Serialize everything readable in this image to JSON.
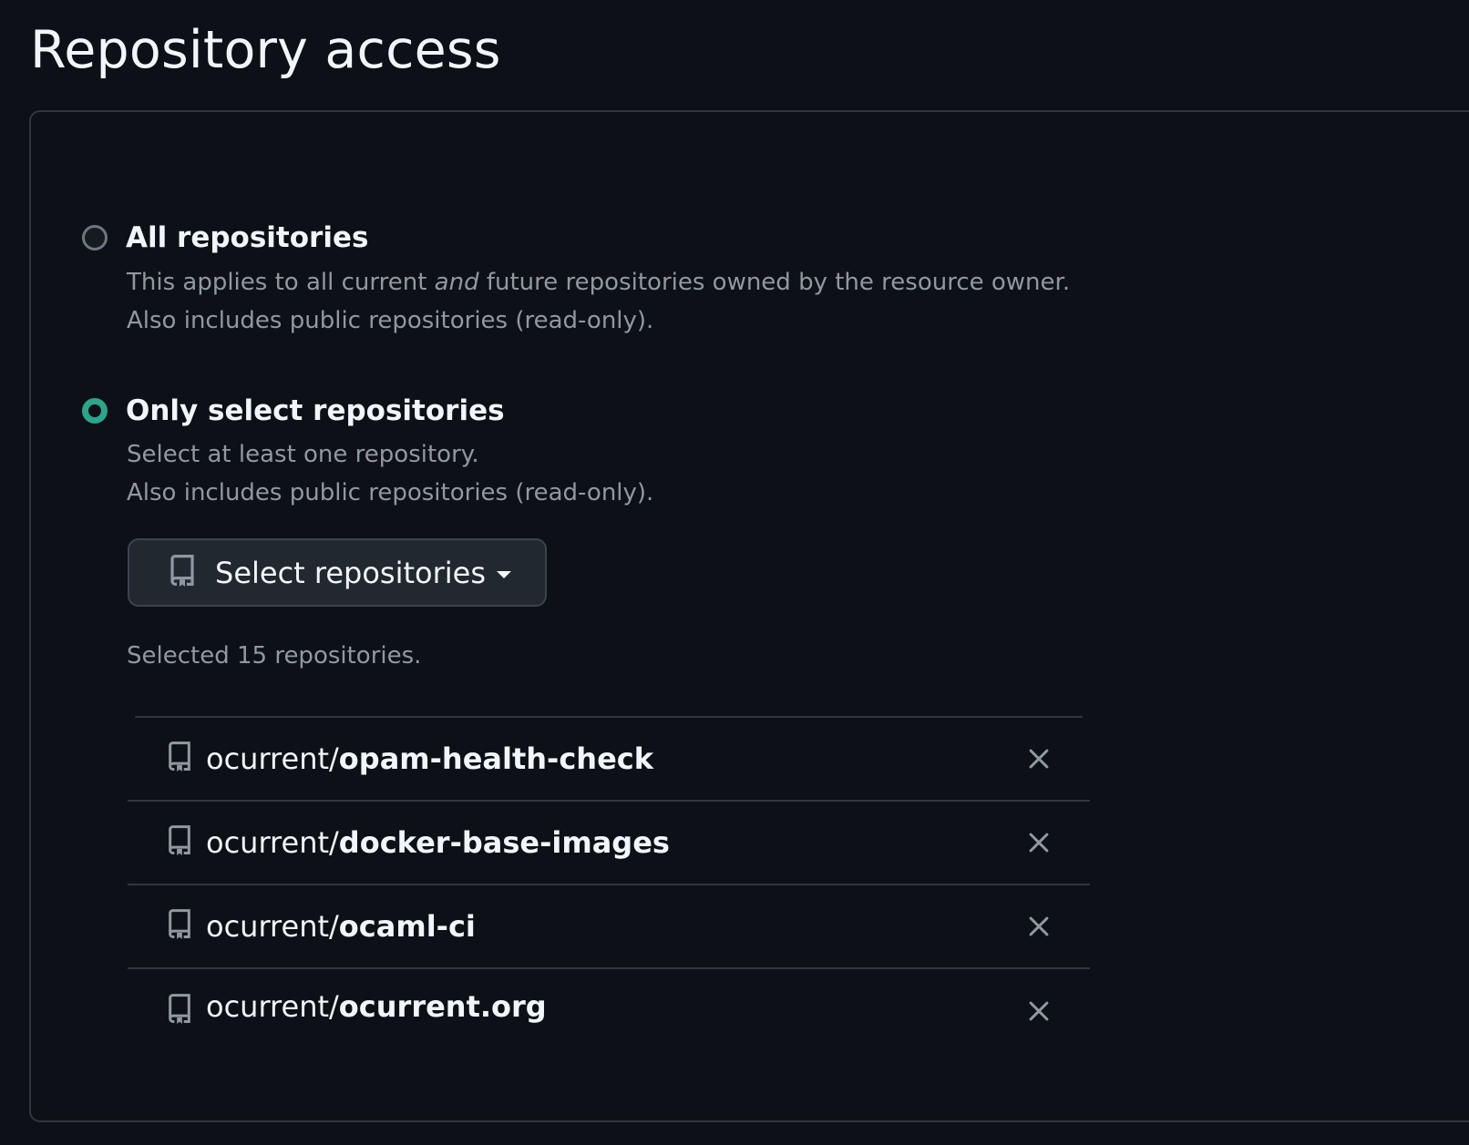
{
  "page": {
    "title": "Repository access"
  },
  "options": {
    "all": {
      "label": "All repositories",
      "desc_prefix": "This applies to all current ",
      "desc_em": "and",
      "desc_suffix": " future repositories owned by the resource owner.",
      "desc_line2": "Also includes public repositories (read-only).",
      "checked": false
    },
    "select": {
      "label": "Only select repositories",
      "desc_line1": "Select at least one repository.",
      "desc_line2": "Also includes public repositories (read-only).",
      "checked": true
    }
  },
  "select_button": {
    "label": "Select repositories",
    "icon": "repo-icon"
  },
  "selected_count_text": "Selected 15 repositories.",
  "repositories": [
    {
      "owner": "ocurrent",
      "slash": "/",
      "name": "opam-health-check"
    },
    {
      "owner": "ocurrent",
      "slash": "/",
      "name": "docker-base-images"
    },
    {
      "owner": "ocurrent",
      "slash": "/",
      "name": "ocaml-ci"
    },
    {
      "owner": "ocurrent",
      "slash": "/",
      "name": "ocurrent.org"
    }
  ],
  "colors": {
    "background": "#0d1117",
    "border": "#30363d",
    "accent_radio": "#2ea38a",
    "muted_text": "#9198a1"
  }
}
